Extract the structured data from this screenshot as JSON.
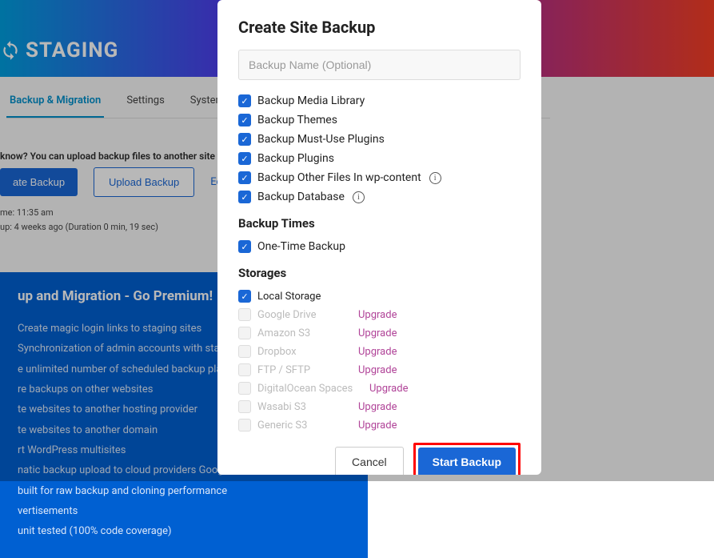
{
  "bg": {
    "logo_text": "STAGING",
    "tabs": [
      "Backup & Migration",
      "Settings",
      "System Info"
    ],
    "note": "know? You can upload backup files to another site to tran",
    "buttons": {
      "create": "ate Backup",
      "upload": "Upload Backup",
      "edit": "Edit Backup"
    },
    "meta": {
      "time": "me: 11:35 am",
      "last": "up: 4 weeks ago (Duration 0 min, 19 sec)"
    }
  },
  "premium": {
    "title": "up and Migration - Go Premium!",
    "items": [
      "Create magic login links to staging sites",
      "Synchronization of admin accounts with staging sites",
      "e unlimited number of scheduled backup plans",
      "re backups on other websites",
      "te websites to another hosting provider",
      "te websites to another domain",
      "rt WordPress multisites",
      "natic backup upload to cloud providers Google Drive, A",
      "built for raw backup and cloning performance",
      "vertisements",
      "unit tested (100% code coverage)"
    ]
  },
  "modal": {
    "title": "Create Site Backup",
    "placeholder": "Backup Name (Optional)",
    "options": [
      "Backup Media Library",
      "Backup Themes",
      "Backup Must-Use Plugins",
      "Backup Plugins",
      "Backup Other Files In wp-content",
      "Backup Database"
    ],
    "sections": {
      "times": "Backup Times",
      "storages": "Storages"
    },
    "times_option": "One-Time Backup",
    "storages": [
      {
        "label": "Local Storage",
        "active": true
      },
      {
        "label": "Google Drive",
        "active": false
      },
      {
        "label": "Amazon S3",
        "active": false
      },
      {
        "label": "Dropbox",
        "active": false
      },
      {
        "label": "FTP / SFTP",
        "active": false
      },
      {
        "label": "DigitalOcean Spaces",
        "active": false
      },
      {
        "label": "Wasabi S3",
        "active": false
      },
      {
        "label": "Generic S3",
        "active": false
      }
    ],
    "upgrade_label": "Upgrade",
    "cancel": "Cancel",
    "start": "Start Backup"
  }
}
